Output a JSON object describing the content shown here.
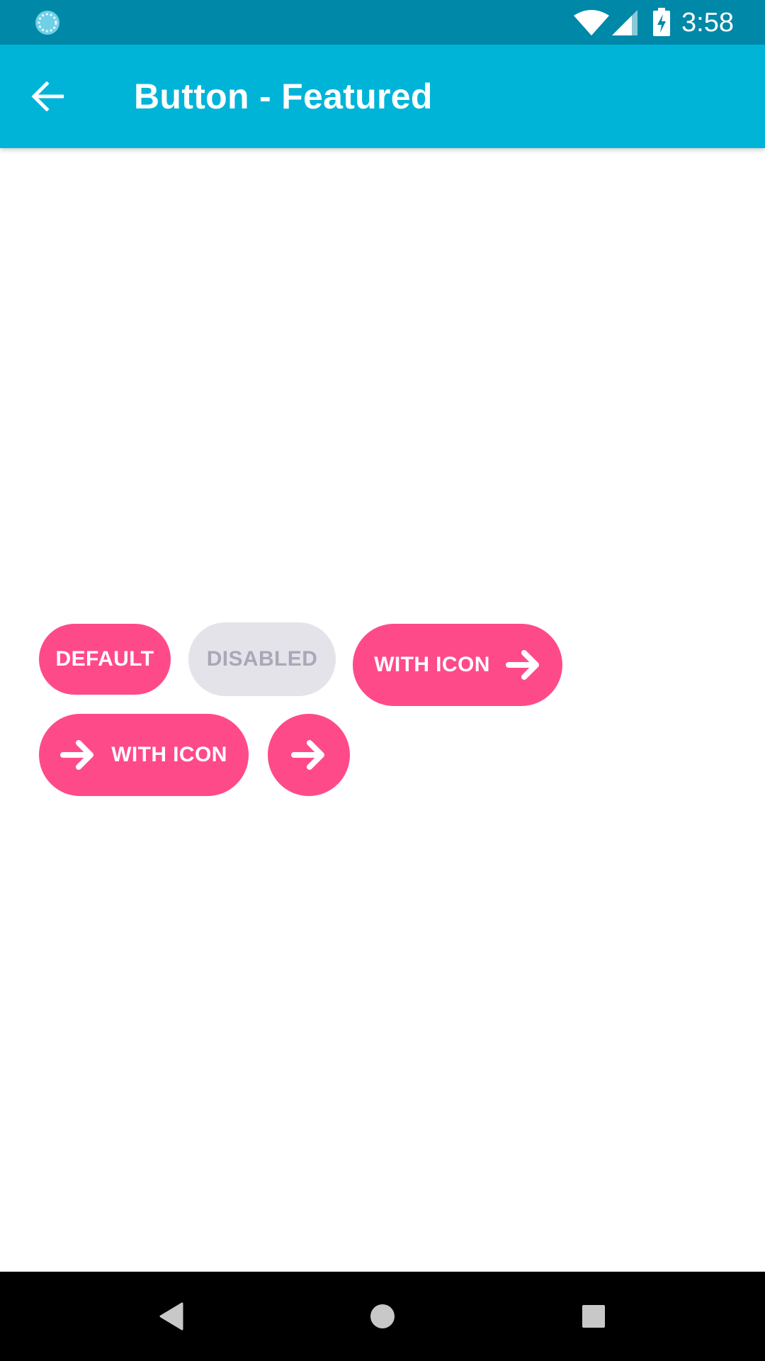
{
  "status_bar": {
    "time": "3:58",
    "app_icon": "sync-indicator-icon",
    "wifi_icon": "wifi-icon",
    "signal_icon": "cell-signal-icon",
    "battery_icon": "battery-charging-icon",
    "background_color": "#0088a8"
  },
  "app_bar": {
    "title": "Button - Featured",
    "back_icon": "arrow-left-icon",
    "background_color": "#00b4d8"
  },
  "buttons": {
    "default_label": "DEFAULT",
    "disabled_label": "DISABLED",
    "with_icon_right_label": "WITH ICON",
    "with_icon_left_label": "WITH ICON",
    "icon_only_icon": "arrow-right-icon",
    "accent_color": "#ff4a8a",
    "disabled_color": "#e4e3ea",
    "disabled_text_color": "#a9a8b7"
  },
  "nav_bar": {
    "back_icon": "nav-back-triangle-icon",
    "home_icon": "nav-home-circle-icon",
    "recents_icon": "nav-recents-square-icon"
  }
}
